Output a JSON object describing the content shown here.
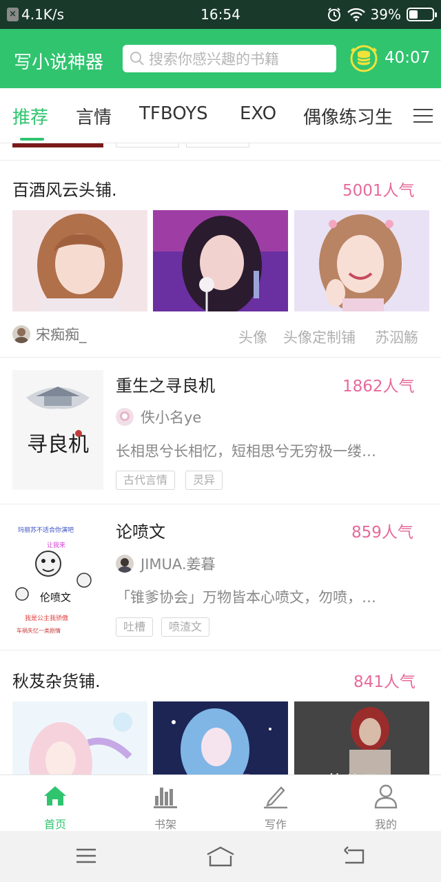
{
  "status_bar": {
    "net_speed": "4.1K/s",
    "time": "16:54",
    "battery": "39%",
    "battery_level": 0.39
  },
  "header": {
    "title": "写小说神器",
    "search_placeholder": "搜索你感兴趣的书籍",
    "timer": "40:07"
  },
  "tabs": [
    {
      "label": "推荐",
      "active": true
    },
    {
      "label": "言情",
      "active": false
    },
    {
      "label": "TFBOYS",
      "active": false
    },
    {
      "label": "EXO",
      "active": false
    },
    {
      "label": "偶像练习生",
      "active": false
    }
  ],
  "feed": {
    "shop1": {
      "title": "百酒风云头铺.",
      "popularity": "5001人气",
      "owner": "宋痴痴_",
      "tags": [
        "头像",
        "头像定制铺",
        "苏泅觞"
      ]
    },
    "book1": {
      "title": "重生之寻良机",
      "popularity": "1862人气",
      "author": "佚小名ye",
      "description": "长相思兮长相忆，短相思兮无穷极一缕…",
      "chips": [
        "古代言情",
        "灵异"
      ],
      "cover_text": "寻良机"
    },
    "book2": {
      "title": "论喷文",
      "popularity": "859人气",
      "author": "JIMUA.姜暮",
      "description": "「锥爹协会」万物皆本心喷文，勿喷，…",
      "chips": [
        "吐槽",
        "喷渣文"
      ],
      "cover_text": "伦喷文"
    },
    "shop2": {
      "title": "秋芨杂货铺.",
      "popularity": "841人气"
    }
  },
  "bottom_nav": [
    {
      "label": "首页",
      "icon": "home-icon",
      "active": true
    },
    {
      "label": "书架",
      "icon": "bookshelf-icon",
      "active": false
    },
    {
      "label": "写作",
      "icon": "pencil-icon",
      "active": false
    },
    {
      "label": "我的",
      "icon": "profile-icon",
      "active": false
    }
  ],
  "colors": {
    "brand_green": "#30c46f",
    "popularity_pink": "#e66a9a",
    "status_bar": "#19392a"
  }
}
